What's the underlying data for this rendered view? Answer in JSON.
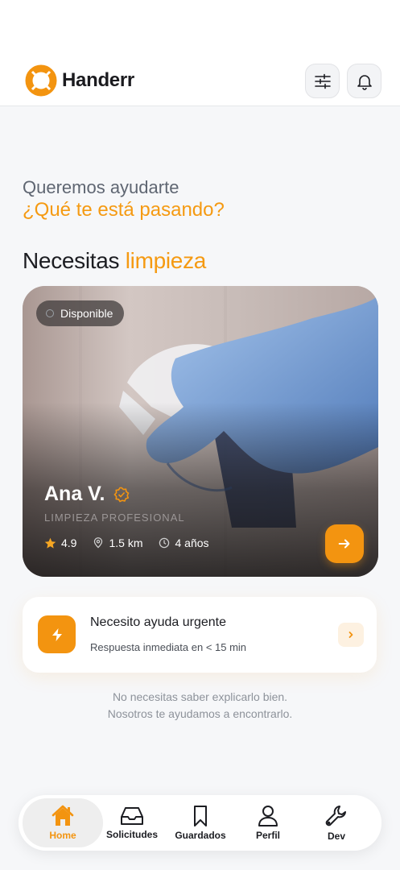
{
  "header": {
    "brand": "Handerr",
    "icons": [
      "lifebuoy-logo-icon",
      "sliders-icon",
      "bell-icon"
    ]
  },
  "greeting": {
    "line1": "Queremos ayudarte",
    "line2": "¿Qué te está pasando?"
  },
  "section": {
    "prefix": "Necesitas",
    "highlight": "limpieza"
  },
  "provider_card": {
    "status": "Disponible",
    "name": "Ana V.",
    "role": "LIMPIEZA PROFESIONAL",
    "rating": "4.9",
    "distance": "1.5 km",
    "experience": "4 años"
  },
  "urgent": {
    "title": "Necesito ayuda urgente",
    "subtitle": "Respuesta inmediata en < 15 min"
  },
  "hint": {
    "line1": "No necesitas saber explicarlo bien.",
    "line2": "Nosotros te ayudamos a encontrarlo."
  },
  "tabbar": {
    "items": [
      {
        "label": "Home",
        "icon": "home-icon",
        "active": true
      },
      {
        "label": "Solicitudes",
        "icon": "inbox-icon",
        "active": false
      },
      {
        "label": "Guardados",
        "icon": "bookmark-icon",
        "active": false
      },
      {
        "label": "Perfil",
        "icon": "user-icon",
        "active": false
      },
      {
        "label": "Dev",
        "icon": "wrench-icon",
        "active": false
      }
    ]
  },
  "colors": {
    "accent": "#f39410",
    "text_dark": "#1c1d22",
    "muted": "#8d929a"
  }
}
